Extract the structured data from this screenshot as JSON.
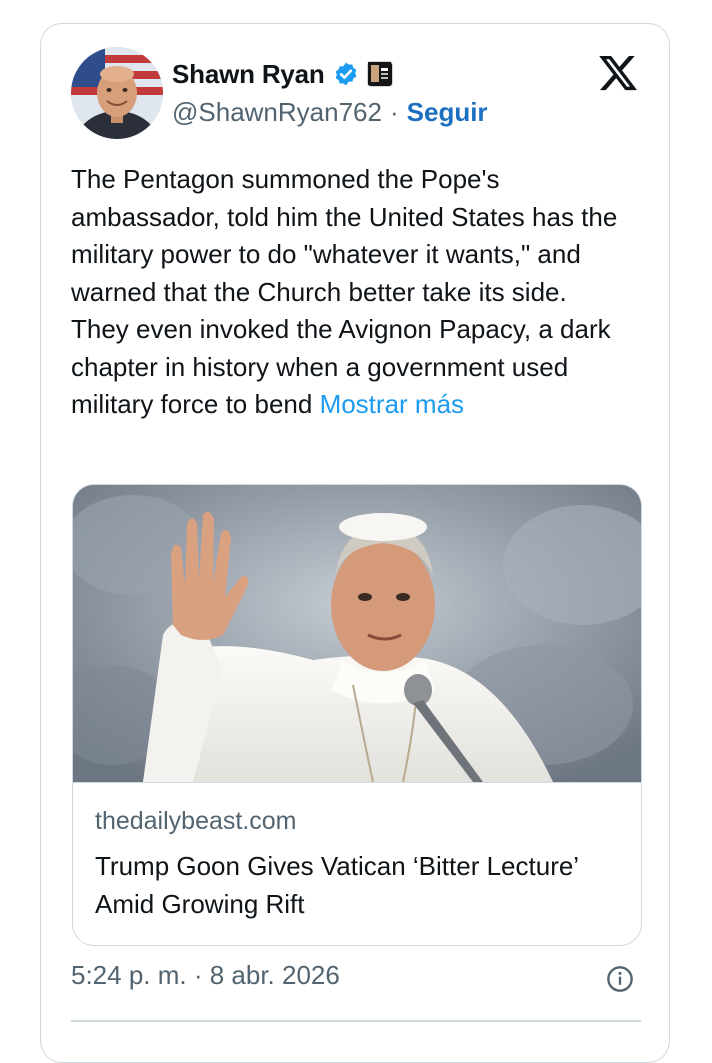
{
  "author": {
    "display_name": "Shawn Ryan",
    "handle": "@ShawnRyan762",
    "separator": "·",
    "follow_label": "Seguir",
    "verified_icon": "verified-badge-icon",
    "affiliate_icon": "affiliate-badge-icon"
  },
  "platform": {
    "logo_icon": "x-logo-icon"
  },
  "tweet": {
    "paragraph_1": "The Pentagon summoned the Pope's ambassador, told him the United States has the military power to do \"whatever it wants,\" and warned that the Church better take its side.",
    "paragraph_2": "They even invoked the Avignon Papacy, a dark chapter in history when a government used military force to bend",
    "show_more": "Mostrar más"
  },
  "link_card": {
    "domain": "thedailybeast.com",
    "title": "Trump Goon Gives Vatican ‘Bitter Lecture’ Amid Growing Rift"
  },
  "meta": {
    "timestamp": "5:24 p. m. · 8 abr. 2026",
    "info_icon": "info-icon"
  },
  "colors": {
    "accent": "#1d9bf0",
    "follow": "#1d6fc0",
    "muted_text": "#536471",
    "border": "#cfd9de",
    "verified": "#1d9bf0"
  }
}
